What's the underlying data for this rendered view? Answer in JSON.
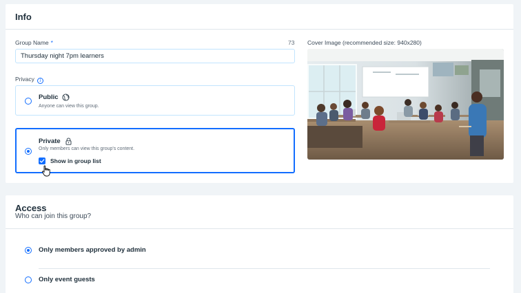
{
  "info": {
    "title": "Info",
    "group_name": {
      "label": "Group Name",
      "required_mark": "*",
      "counter": "73",
      "value": "Thursday night 7pm learners"
    },
    "privacy": {
      "label": "Privacy",
      "info_glyph": "i",
      "options": [
        {
          "title": "Public",
          "description": "Anyone can view this group.",
          "icon": "globe-icon",
          "selected": false
        },
        {
          "title": "Private",
          "description": "Only members can view this group's content.",
          "icon": "lock-icon",
          "selected": true
        }
      ],
      "show_in_list": {
        "label": "Show in group list",
        "checked": true
      }
    },
    "cover_image": {
      "label": "Cover Image (recommended size: 940x280)"
    }
  },
  "access": {
    "title": "Access",
    "subtitle": "Who can join this group?",
    "options": [
      {
        "label": "Only members approved by admin",
        "selected": true
      },
      {
        "label": "Only event guests",
        "selected": false
      }
    ]
  },
  "colors": {
    "accent": "#116dff",
    "border_light": "#c1e4fe",
    "page_bg": "#f0f4f7",
    "text_primary": "#20303c"
  }
}
